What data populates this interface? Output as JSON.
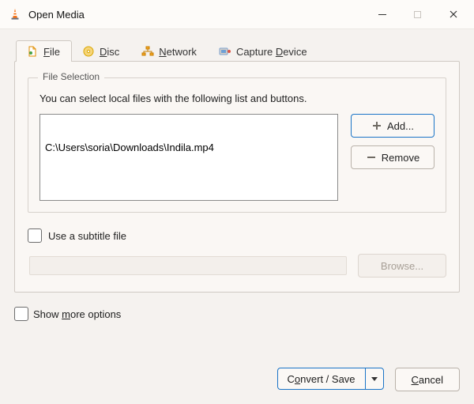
{
  "window": {
    "title": "Open Media",
    "app_icon": "vlc-cone-icon"
  },
  "tabs": {
    "file": {
      "label_pre": "",
      "accel": "F",
      "label_post": "ile",
      "icon": "file-icon"
    },
    "disc": {
      "label_pre": "",
      "accel": "D",
      "label_post": "isc",
      "icon": "disc-icon"
    },
    "network": {
      "label_pre": "",
      "accel": "N",
      "label_post": "etwork",
      "icon": "network-icon"
    },
    "capture": {
      "label_pre": "Capture ",
      "accel": "D",
      "label_post": "evice",
      "icon": "capture-icon"
    }
  },
  "file_selection": {
    "legend": "File Selection",
    "hint": "You can select local files with the following list and buttons.",
    "items": [
      "C:\\Users\\soria\\Downloads\\Indila.mp4"
    ],
    "add_label": "Add...",
    "remove_label": "Remove"
  },
  "subtitle": {
    "use_label": "Use a subtitle file",
    "browse_label": "Browse..."
  },
  "more_options": {
    "label_pre": "Show ",
    "accel": "m",
    "label_post": "ore options"
  },
  "footer": {
    "convert_pre": "C",
    "convert_accel": "o",
    "convert_post": "nvert / Save",
    "cancel_pre": "",
    "cancel_accel": "C",
    "cancel_post": "ancel"
  }
}
